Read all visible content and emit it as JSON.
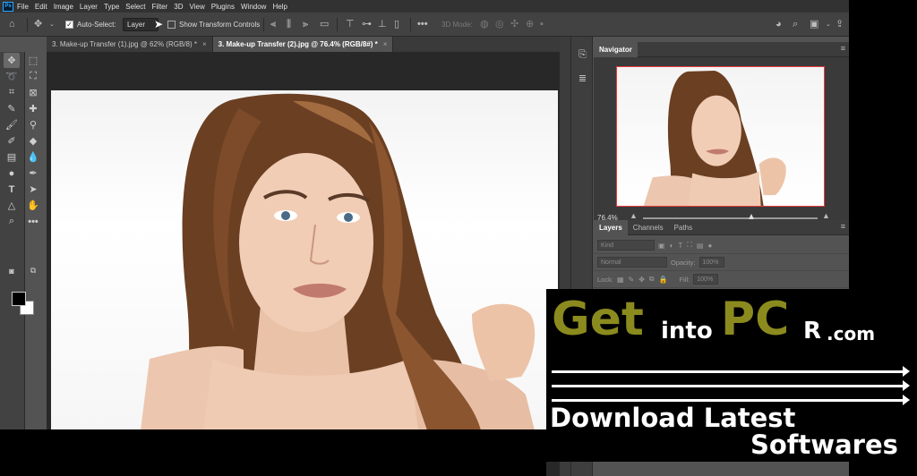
{
  "menubar": {
    "logo": "Ps",
    "items": [
      "File",
      "Edit",
      "Image",
      "Layer",
      "Type",
      "Select",
      "Filter",
      "3D",
      "View",
      "Plugins",
      "Window",
      "Help"
    ]
  },
  "options": {
    "auto_select_label": "Auto-Select:",
    "auto_select_value": "Layer",
    "transform_label": "Show Transform Controls",
    "mode_3d_label": "3D Mode:"
  },
  "tabs": [
    {
      "label": "3. Make-up Transfer (1).jpg @ 62% (RGB/8) *",
      "close": "×"
    },
    {
      "label": "3. Make-up Transfer (2).jpg @ 76.4% (RGB/8#) *",
      "close": "×"
    }
  ],
  "navigator": {
    "title": "Navigator",
    "zoom": "76.4%",
    "zoom_fraction": 0.62
  },
  "layers": {
    "tabs": [
      "Layers",
      "Channels",
      "Paths"
    ],
    "kind_placeholder": "Kind",
    "blend_mode": "Normal",
    "opacity_label": "Opacity:",
    "opacity_value": "100%",
    "lock_label": "Lock:",
    "fill_label": "Fill:",
    "fill_value": "100%"
  },
  "banner": {
    "get": "Get",
    "into": "into",
    "pc": "PC",
    "r": "R",
    "com": ".com",
    "line1": "Download Latest",
    "line2": "Softwares"
  },
  "colors": {
    "ui_bg": "#535353",
    "menubar": "#323232",
    "accent_blue": "#31a8ff",
    "banner_olive": "#8b8a1e"
  }
}
